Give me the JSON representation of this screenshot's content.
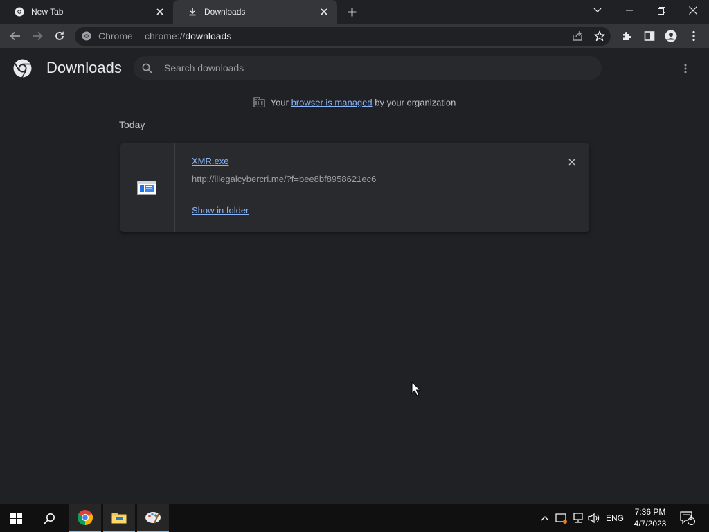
{
  "browser": {
    "tabs": [
      {
        "title": "New Tab",
        "icon": "chrome-icon"
      },
      {
        "title": "Downloads",
        "icon": "download-icon",
        "active": true
      }
    ],
    "omnibox": {
      "site_label": "Chrome",
      "url_scheme": "chrome://",
      "url_host": "downloads"
    }
  },
  "downloads_page": {
    "title": "Downloads",
    "search_placeholder": "Search downloads",
    "managed_notice": {
      "prefix": "Your",
      "link": "browser is managed",
      "suffix": "by your organization"
    },
    "date_header": "Today",
    "items": [
      {
        "file_name": "XMR.exe",
        "url": "http://illegalcybercri.me/?f=bee8bf8958621ec6",
        "action_label": "Show in folder"
      }
    ]
  },
  "taskbar": {
    "apps": [
      "start",
      "search",
      "chrome",
      "file-explorer",
      "paint"
    ],
    "language": "ENG",
    "time": "7:36 PM",
    "date": "4/7/2023",
    "notification_count": "1"
  },
  "colors": {
    "background": "#202124",
    "toolbar": "#35363a",
    "link": "#8ab4f8",
    "taskbar": "#101010"
  }
}
